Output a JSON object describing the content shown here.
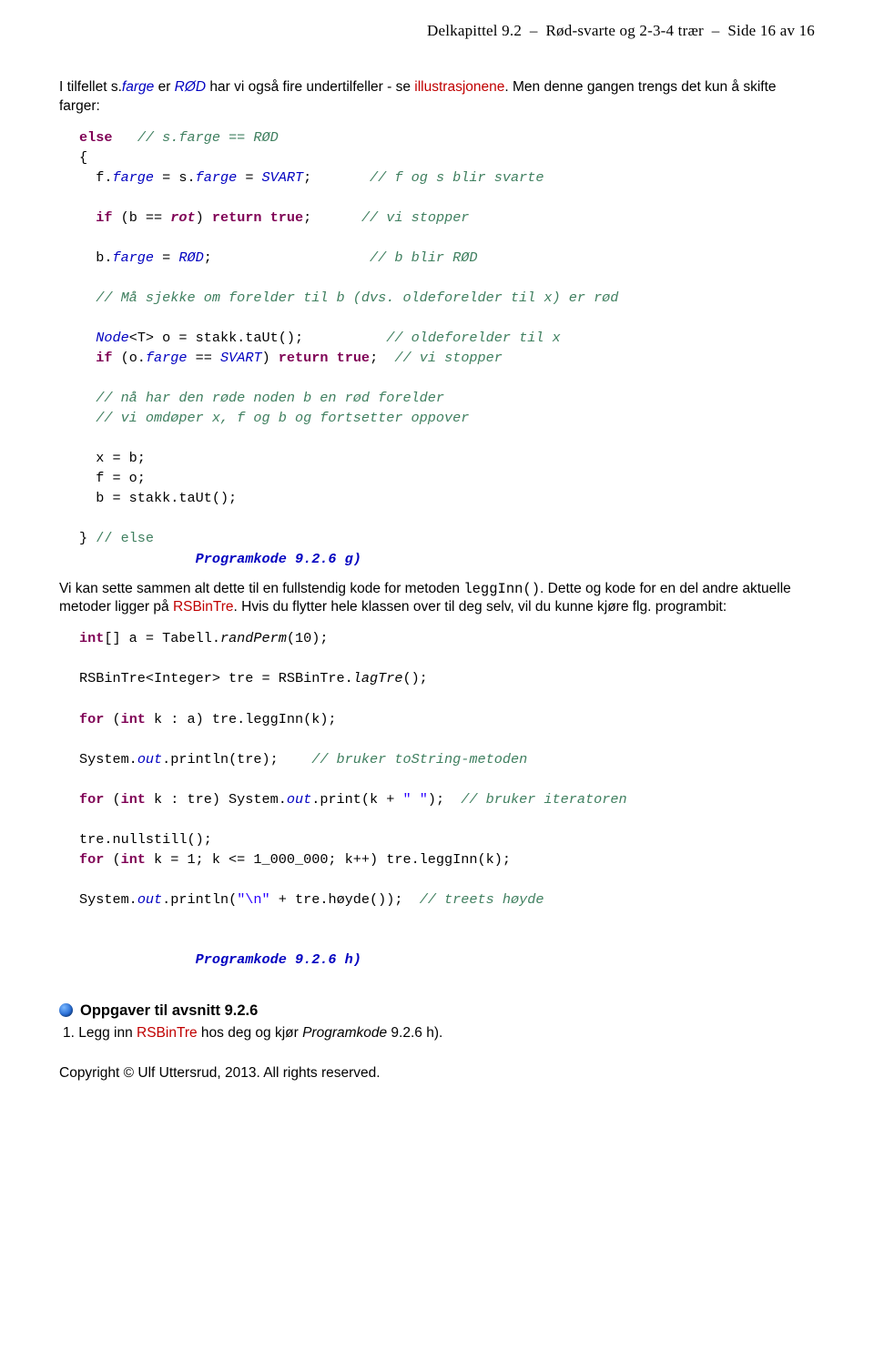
{
  "header": {
    "chapter": "Delkapittel 9.2",
    "title": "Rød-svarte og 2-3-4 trær",
    "page": "Side 16 av 16"
  },
  "intro": {
    "t1": "I tilfellet s.",
    "t2": "farge",
    "t3": " er ",
    "t4": "RØD",
    "t5": " har vi også fire undertilfeller - se ",
    "t6": "illustrasjonene",
    "t7": ". Men denne gangen trengs det kun å skifte farger:"
  },
  "code1": {
    "l1a": "else",
    "l1b": "   ",
    "l1c": "// s.farge == RØD",
    "l2": "{",
    "l3a": "  f.",
    "l3b": "farge",
    "l3c": " = s.",
    "l3d": "farge",
    "l3e": " = ",
    "l3f": "SVART",
    "l3g": ";       ",
    "l3h": "// f og s blir svarte",
    "l5a": "  ",
    "l5b": "if",
    "l5c": " (b == ",
    "l5d": "rot",
    "l5e": ") ",
    "l5f": "return true",
    "l5g": ";      ",
    "l5h": "// vi stopper",
    "l7a": "  b.",
    "l7b": "farge",
    "l7c": " = ",
    "l7d": "RØD",
    "l7e": ";                   ",
    "l7f": "// b blir RØD",
    "l9": "  // Må sjekke om forelder til b (dvs. oldeforelder til x) er rød",
    "l11a": "  ",
    "l11b": "Node",
    "l11c": "<T> o = stakk.taUt();          ",
    "l11d": "// oldeforelder til x",
    "l12a": "  ",
    "l12b": "if",
    "l12c": " (o.",
    "l12d": "farge",
    "l12e": " == ",
    "l12f": "SVART",
    "l12g": ") ",
    "l12h": "return true",
    "l12i": ";  ",
    "l12j": "// vi stopper",
    "l14": "  // nå har den røde noden b en rød forelder",
    "l15": "  // vi omdøper x, f og b og fortsetter oppover",
    "l17": "  x = b;",
    "l18": "  f = o;",
    "l19": "  b = stakk.taUt();",
    "l21a": "} ",
    "l21b": "// else",
    "cap": "Programkode 9.2.6 g)"
  },
  "mid": {
    "p1a": "Vi kan sette sammen alt dette til en fullstendig kode for metoden ",
    "p1b": "leggInn()",
    "p1c": ". Dette og kode for en del andre aktuelle metoder ligger på ",
    "p1d": "RSBinTre",
    "p1e": ". Hvis du flytter hele klassen over til deg selv, vil du kunne kjøre flg. programbit:"
  },
  "code2": {
    "l1a": "int",
    "l1b": "[] a = Tabell.",
    "l1c": "randPerm",
    "l1d": "(10);",
    "l3a": "RSBinTre<Integer> tre = RSBinTre.",
    "l3b": "lagTre",
    "l3c": "();",
    "l5a": "for",
    "l5b": " (",
    "l5c": "int",
    "l5d": " k : a) tre.leggInn(k);",
    "l7a": "System.",
    "l7b": "out",
    "l7c": ".println(tre);    ",
    "l7d": "// bruker toString-metoden",
    "l9a": "for",
    "l9b": " (",
    "l9c": "int",
    "l9d": " k : tre) System.",
    "l9e": "out",
    "l9f": ".print(k + ",
    "l9g": "\" \"",
    "l9h": ");  ",
    "l9i": "// bruker iteratoren",
    "l11": "tre.nullstill();",
    "l12a": "for",
    "l12b": " (",
    "l12c": "int",
    "l12d": " k = 1; k <= 1_000_000; k++) tre.leggInn(k);",
    "l14a": "System.",
    "l14b": "out",
    "l14c": ".println(",
    "l14d": "\"\\n\"",
    "l14e": " + tre.høyde());  ",
    "l14f": "// treets høyde",
    "cap": "Programkode 9.2.6 h)"
  },
  "tasks": {
    "heading": "Oppgaver til avsnitt 9.2.6",
    "t1a": "1. Legg inn ",
    "t1b": "RSBinTre",
    "t1c": " hos deg og kjør ",
    "t1d": "Programkode",
    "t1e": " 9.2.6 h)."
  },
  "footer": {
    "copyright": "Copyright © Ulf Uttersrud, 2013. All rights reserved."
  }
}
